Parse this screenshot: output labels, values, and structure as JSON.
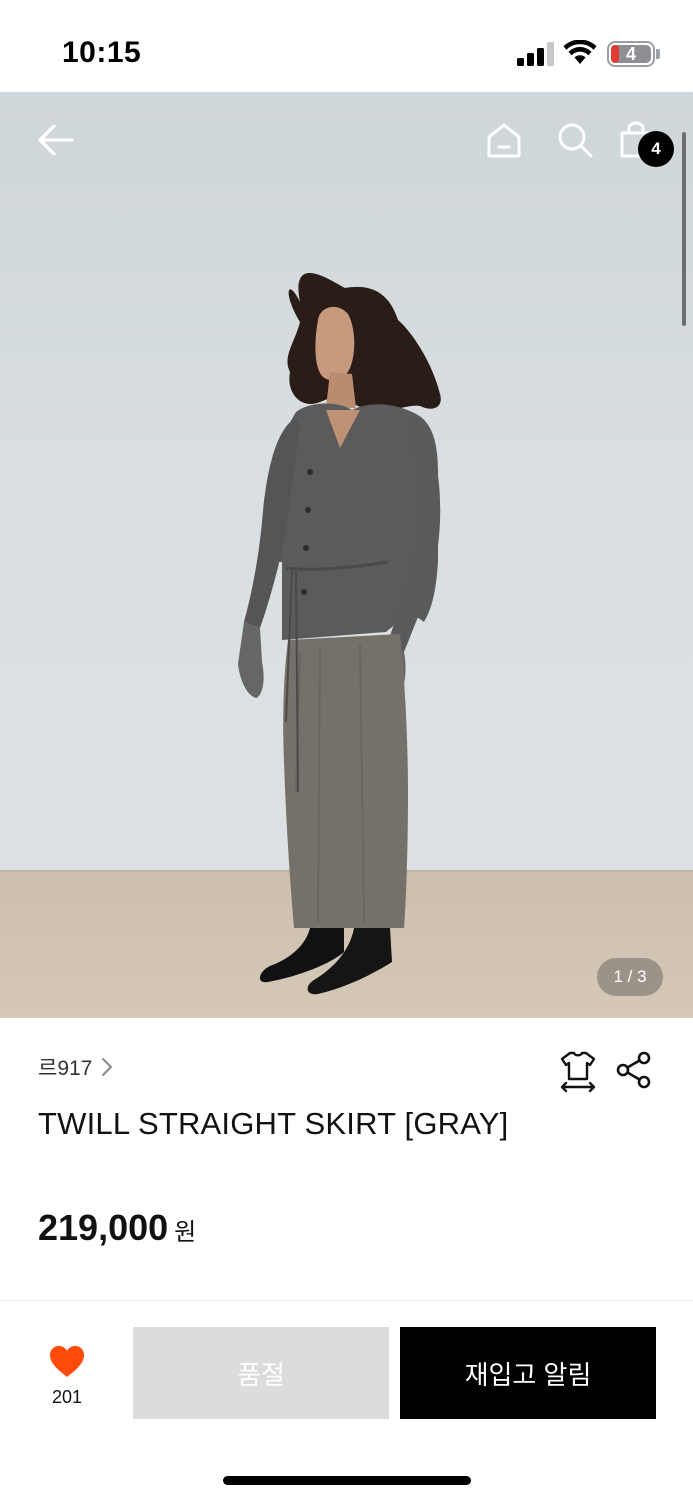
{
  "status_bar": {
    "time": "10:15",
    "battery_level": "4",
    "icons": [
      "signal-icon",
      "wifi-icon",
      "battery-icon"
    ]
  },
  "header": {
    "icons": [
      "back-arrow-icon",
      "home-icon",
      "search-icon",
      "shopping-bag-icon"
    ],
    "cart_count": "4"
  },
  "gallery": {
    "pager": "1 / 3",
    "current_index": 1,
    "total": 3
  },
  "product": {
    "brand": "르917",
    "title": "TWILL STRAIGHT SKIRT [GRAY]",
    "price": "219,000",
    "currency": "원",
    "icons": [
      "size-guide-icon",
      "share-icon"
    ]
  },
  "bottom_bar": {
    "like_count": "201",
    "soldout_label": "품절",
    "restock_label": "재입고 알림",
    "colors": {
      "heart": "#ff4b0a",
      "soldout_bg": "#dcdcdc",
      "restock_bg": "#000000"
    }
  }
}
